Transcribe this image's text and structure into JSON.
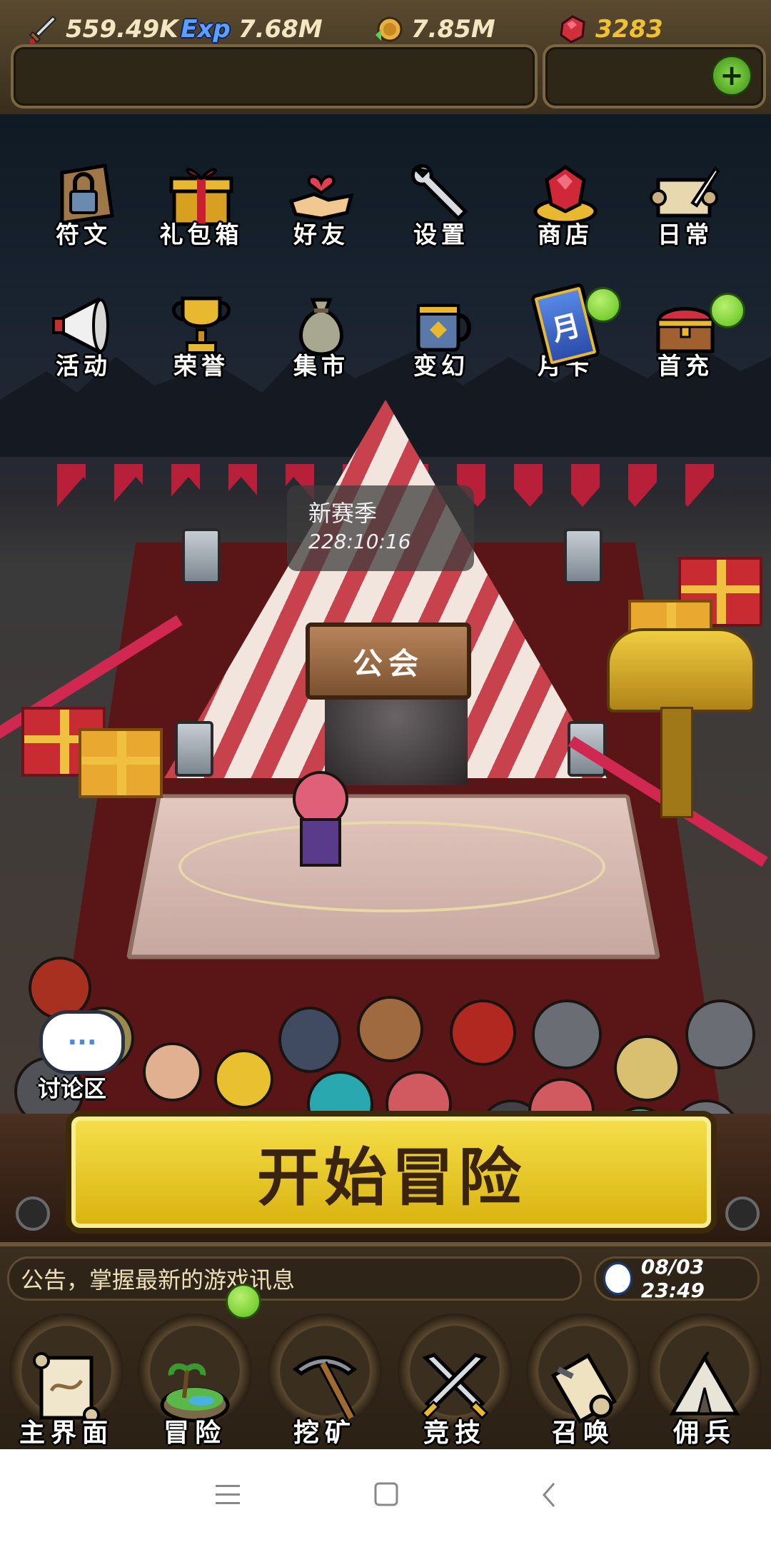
{
  "resources": {
    "attack": "559.49K",
    "exp": "7.68M",
    "gold": "7.85M",
    "gems": "3283",
    "exp_icon_text": "Exp"
  },
  "menu_row1": [
    {
      "label": "符文",
      "icon": "rune-lock-icon"
    },
    {
      "label": "礼包箱",
      "icon": "gift-box-icon"
    },
    {
      "label": "好友",
      "icon": "handshake-icon"
    },
    {
      "label": "设置",
      "icon": "wrench-icon"
    },
    {
      "label": "商店",
      "icon": "ruby-shop-icon"
    },
    {
      "label": "日常",
      "icon": "scroll-quill-icon"
    }
  ],
  "menu_row2": [
    {
      "label": "活动",
      "icon": "megaphone-icon"
    },
    {
      "label": "荣誉",
      "icon": "trophy-icon"
    },
    {
      "label": "集市",
      "icon": "money-bag-icon"
    },
    {
      "label": "变幻",
      "icon": "mug-icon"
    },
    {
      "label": "月卡",
      "icon": "month-card-icon",
      "card_char": "月"
    },
    {
      "label": "首充",
      "icon": "treasure-chest-icon"
    }
  ],
  "season": {
    "title": "新赛季",
    "timer": "228:10:16"
  },
  "guild_sign": "公会",
  "chat": {
    "label": "讨论区",
    "bubble": "···"
  },
  "start_button": "开始冒险",
  "notice": "公告，掌握最新的游戏讯息",
  "clock": "08/03 23:49",
  "nav": [
    {
      "label": "主界面",
      "icon": "map-scroll-icon"
    },
    {
      "label": "冒险",
      "icon": "island-icon"
    },
    {
      "label": "挖矿",
      "icon": "pickaxe-icon"
    },
    {
      "label": "竞技",
      "icon": "crossed-swords-icon"
    },
    {
      "label": "召唤",
      "icon": "summon-scroll-icon"
    },
    {
      "label": "佣兵",
      "icon": "tent-icon"
    }
  ],
  "colors": {
    "accent_gold": "#f0c040",
    "badge_green": "#5cc01a",
    "gem_red": "#d0303c"
  }
}
